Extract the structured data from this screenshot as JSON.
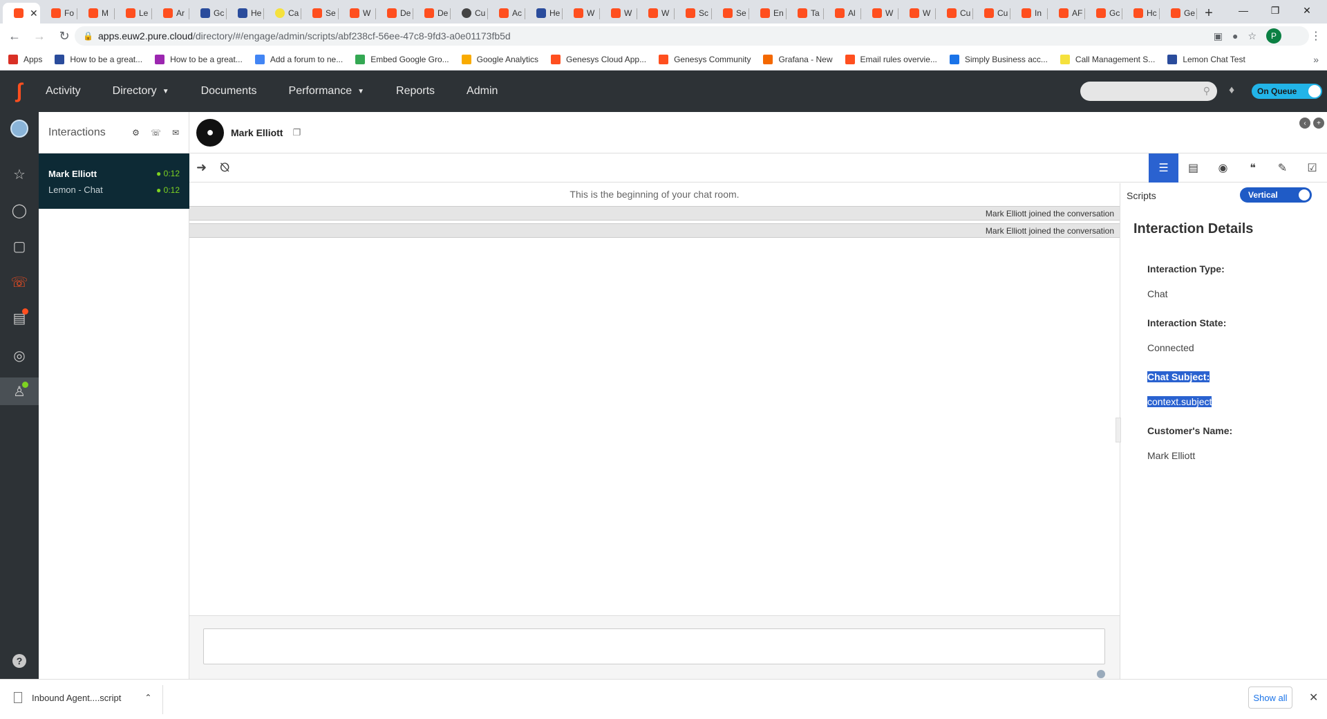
{
  "browser": {
    "tabs": [
      {
        "label": "",
        "fav": "g",
        "active": true
      },
      {
        "label": "Fo",
        "fav": "g"
      },
      {
        "label": "M",
        "fav": "g"
      },
      {
        "label": "Le",
        "fav": "g"
      },
      {
        "label": "Ar",
        "fav": "g"
      },
      {
        "label": "Gc",
        "fav": "b"
      },
      {
        "label": "He",
        "fav": "b"
      },
      {
        "label": "Ca",
        "fav": "y"
      },
      {
        "label": "Se",
        "fav": "g"
      },
      {
        "label": "W",
        "fav": "g"
      },
      {
        "label": "De",
        "fav": "g"
      },
      {
        "label": "De",
        "fav": "g"
      },
      {
        "label": "Cu",
        "fav": "c"
      },
      {
        "label": "Ac",
        "fav": "g"
      },
      {
        "label": "He",
        "fav": "b"
      },
      {
        "label": "W",
        "fav": "g"
      },
      {
        "label": "W",
        "fav": "g"
      },
      {
        "label": "W",
        "fav": "g"
      },
      {
        "label": "Sc",
        "fav": "g"
      },
      {
        "label": "Se",
        "fav": "g"
      },
      {
        "label": "En",
        "fav": "g"
      },
      {
        "label": "Ta",
        "fav": "g"
      },
      {
        "label": "Al",
        "fav": "g"
      },
      {
        "label": "W",
        "fav": "g"
      },
      {
        "label": "W",
        "fav": "g"
      },
      {
        "label": "Cu",
        "fav": "g"
      },
      {
        "label": "Cu",
        "fav": "g"
      },
      {
        "label": "In",
        "fav": "g"
      },
      {
        "label": "AF",
        "fav": "g"
      },
      {
        "label": "Gc",
        "fav": "g"
      },
      {
        "label": "Hc",
        "fav": "g"
      },
      {
        "label": "Ge",
        "fav": "g"
      }
    ],
    "url_host": "apps.euw2.pure.cloud",
    "url_path": "/directory/#/engage/admin/scripts/abf238cf-56ee-47c8-9fd3-a0e01173fb5d",
    "profile_initial": "P",
    "bookmarks": [
      {
        "label": "Apps",
        "color": "#d93025"
      },
      {
        "label": "How to be a great...",
        "color": "#2a4c9c"
      },
      {
        "label": "How to be a great...",
        "color": "#9c27b0"
      },
      {
        "label": "Add a forum to ne...",
        "color": "#4285f4"
      },
      {
        "label": "Embed Google Gro...",
        "color": "#34a853"
      },
      {
        "label": "Google Analytics",
        "color": "#f9ab00"
      },
      {
        "label": "Genesys Cloud App...",
        "color": "#ff4f1f"
      },
      {
        "label": "Genesys Community",
        "color": "#ff4f1f"
      },
      {
        "label": "Grafana - New",
        "color": "#f46800"
      },
      {
        "label": "Email rules overvie...",
        "color": "#ff4f1f"
      },
      {
        "label": "Simply Business acc...",
        "color": "#1a73e8"
      },
      {
        "label": "Call Management S...",
        "color": "#f5e13d"
      },
      {
        "label": "Lemon Chat Test",
        "color": "#2a4c9c"
      }
    ]
  },
  "app": {
    "nav": [
      {
        "label": "Activity",
        "caret": false
      },
      {
        "label": "Directory",
        "caret": true
      },
      {
        "label": "Documents",
        "caret": false
      },
      {
        "label": "Performance",
        "caret": true
      },
      {
        "label": "Reports",
        "caret": false
      },
      {
        "label": "Admin",
        "caret": false
      }
    ],
    "queue_label": "On Queue"
  },
  "interactions": {
    "title": "Interactions",
    "card": {
      "name": "Mark Elliott",
      "sub": "Lemon - Chat",
      "time1": "0:12",
      "time2": "0:12"
    }
  },
  "main": {
    "contact_name": "Mark Elliott",
    "chat_begin": "This is the beginning of your chat room.",
    "events": [
      "Mark Elliott joined the conversation",
      "Mark Elliott joined the conversation"
    ]
  },
  "script": {
    "header": "Scripts",
    "toggle_label": "Vertical",
    "title": "Interaction Details",
    "fields": [
      {
        "label": "Interaction Type:",
        "value": "Chat",
        "highlight": false
      },
      {
        "label": "Interaction State:",
        "value": "Connected",
        "highlight": false
      },
      {
        "label": "Chat Subject:",
        "value": "context.subject",
        "highlight": true
      },
      {
        "label": "Customer's Name:",
        "value": "Mark Elliott",
        "highlight": false
      }
    ]
  },
  "downloads": {
    "file": "Inbound Agent....script",
    "show_all": "Show all"
  },
  "colors": {
    "header_bg": "#2d3236",
    "brand_orange": "#ff4f1f",
    "accent_blue": "#2a62d0",
    "queue_cyan": "#22b4e8",
    "timer_green": "#7ed321"
  }
}
